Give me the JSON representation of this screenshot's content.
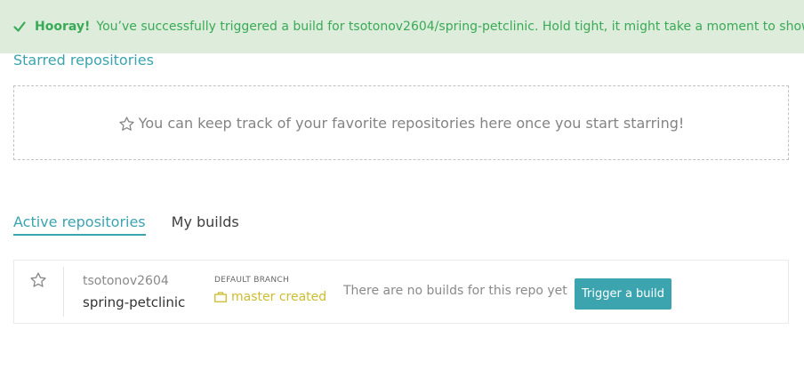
{
  "flash": {
    "icon": "check-icon",
    "strong": "Hooray!",
    "message": "You’ve successfully triggered a build for tsotonov2604/spring-petclinic. Hold tight, it might take a moment to show up.",
    "color": "#39aa56",
    "background": "#deecdc"
  },
  "starred": {
    "title": "Starred repositories",
    "empty_icon": "star-outline-icon",
    "empty_text": "You can keep track of your favorite repositories here once you start starring!"
  },
  "tabs": [
    {
      "label": "Active repositories",
      "active": true
    },
    {
      "label": "My builds",
      "active": false
    }
  ],
  "repo": {
    "star_icon": "star-outline-icon",
    "owner": "tsotonov2604",
    "name": "spring-petclinic",
    "branch_label": "DEFAULT BRANCH",
    "branch_icon": "briefcase-icon",
    "branch_status": "master created",
    "no_builds_text": "There are no builds for this repo yet",
    "trigger_label": "Trigger a build"
  },
  "colors": {
    "accent": "#3ba4ae",
    "branch_created": "#cdbc2e"
  }
}
